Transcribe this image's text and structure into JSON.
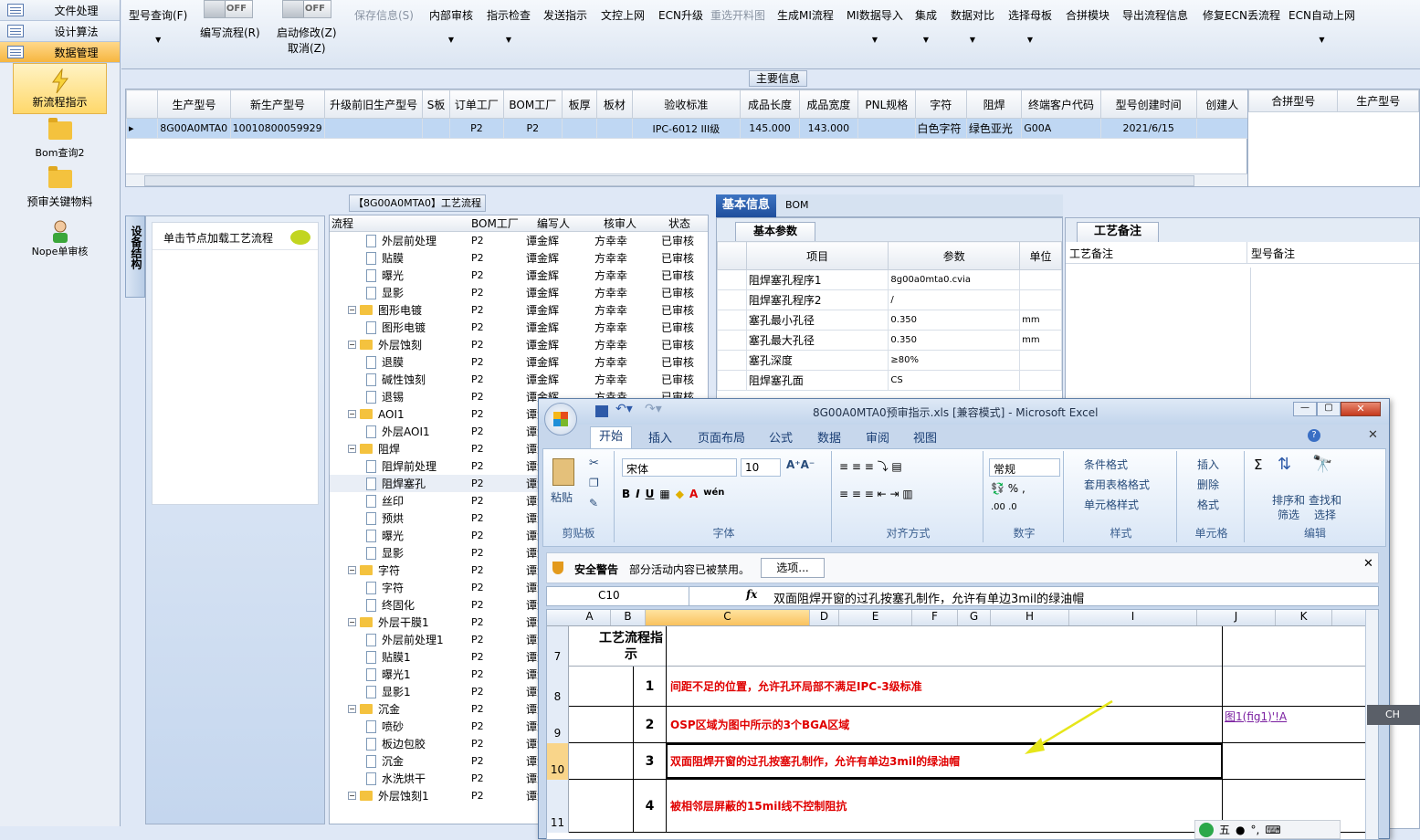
{
  "nav": {
    "top": [
      "文件处理",
      "设计算法",
      "数据管理"
    ],
    "items": [
      "新流程指示",
      "Bom查询2",
      "预审关键物料",
      "Nope单审核"
    ]
  },
  "toolbar": {
    "model_query": "型号查询(F)",
    "write_flow": "编写流程(R)",
    "start_modify": "启动修改(Z)",
    "cancel": "取消(Z)",
    "off": "OFF",
    "buttons": [
      "保存信息(S)",
      "内部审核",
      "指示检查",
      "发送指示",
      "文控上网",
      "ECN升级",
      "重选开料图",
      "生成MI流程",
      "MI数据导入",
      "集成",
      "数据对比",
      "选择母板",
      "合拼模块",
      "导出流程信息",
      "修复ECN丢流程",
      "ECN自动上网"
    ]
  },
  "main_info": {
    "title": "主要信息",
    "headers": [
      "生产型号",
      "新生产型号",
      "升级前旧生产型号",
      "S板",
      "订单工厂",
      "BOM工厂",
      "板厚",
      "板材",
      "验收标准",
      "成品长度",
      "成品宽度",
      "PNL规格",
      "字符",
      "阻焊",
      "终端客户代码",
      "型号创建时间",
      "创建人"
    ],
    "row": [
      "8G00A0MTA0",
      "10010800059929",
      "",
      "",
      "P2",
      "P2",
      "",
      "",
      "IPC-6012 III级",
      "145.000",
      "143.000",
      "",
      "白色字符",
      "绿色亚光",
      "G00A",
      "2021/6/15",
      ""
    ],
    "right_headers": [
      "合拼型号",
      "生产型号"
    ]
  },
  "flow": {
    "title": "【8G00A0MTA0】工艺流程",
    "side_tab": "设备结构",
    "hint": "单击节点加载工艺流程",
    "headers": [
      "流程",
      "BOM工厂",
      "编写人",
      "核审人",
      "状态"
    ],
    "rows": [
      {
        "n": "外层前处理",
        "t": "d",
        "l": 2
      },
      {
        "n": "贴膜",
        "t": "d",
        "l": 2
      },
      {
        "n": "曝光",
        "t": "d",
        "l": 2
      },
      {
        "n": "显影",
        "t": "d",
        "l": 2
      },
      {
        "n": "图形电镀",
        "t": "f",
        "l": 1
      },
      {
        "n": "图形电镀",
        "t": "d",
        "l": 2
      },
      {
        "n": "外层蚀刻",
        "t": "f",
        "l": 1
      },
      {
        "n": "退膜",
        "t": "d",
        "l": 2
      },
      {
        "n": "碱性蚀刻",
        "t": "d",
        "l": 2
      },
      {
        "n": "退锡",
        "t": "d",
        "l": 2
      },
      {
        "n": "AOI1",
        "t": "f",
        "l": 1
      },
      {
        "n": "外层AOI1",
        "t": "d",
        "l": 2
      },
      {
        "n": "阻焊",
        "t": "f",
        "l": 1
      },
      {
        "n": "阻焊前处理",
        "t": "d",
        "l": 2
      },
      {
        "n": "阻焊塞孔",
        "t": "d",
        "l": 2
      },
      {
        "n": "丝印",
        "t": "d",
        "l": 2
      },
      {
        "n": "预烘",
        "t": "d",
        "l": 2
      },
      {
        "n": "曝光",
        "t": "d",
        "l": 2
      },
      {
        "n": "显影",
        "t": "d",
        "l": 2
      },
      {
        "n": "字符",
        "t": "f",
        "l": 1
      },
      {
        "n": "字符",
        "t": "d",
        "l": 2
      },
      {
        "n": "终固化",
        "t": "d",
        "l": 2
      },
      {
        "n": "外层干膜1",
        "t": "f",
        "l": 1
      },
      {
        "n": "外层前处理1",
        "t": "d",
        "l": 2
      },
      {
        "n": "贴膜1",
        "t": "d",
        "l": 2
      },
      {
        "n": "曝光1",
        "t": "d",
        "l": 2
      },
      {
        "n": "显影1",
        "t": "d",
        "l": 2
      },
      {
        "n": "沉金",
        "t": "f",
        "l": 1
      },
      {
        "n": "喷砂",
        "t": "d",
        "l": 2
      },
      {
        "n": "板边包胶",
        "t": "d",
        "l": 2
      },
      {
        "n": "沉金",
        "t": "d",
        "l": 2
      },
      {
        "n": "水洗烘干",
        "t": "d",
        "l": 2
      },
      {
        "n": "外层蚀刻1",
        "t": "f",
        "l": 1
      }
    ],
    "bom": "P2",
    "writer": "谭金辉",
    "reviewer": "方幸幸",
    "status": "已审核"
  },
  "basic": {
    "tabs": [
      "基本信息",
      "BOM"
    ],
    "subtab": "基本参数",
    "headers": [
      "项目",
      "参数",
      "单位"
    ],
    "rows": [
      [
        "阻焊塞孔程序1",
        "8g00a0mta0.cvia",
        ""
      ],
      [
        "阻焊塞孔程序2",
        "/",
        ""
      ],
      [
        "塞孔最小孔径",
        "0.350",
        "mm"
      ],
      [
        "塞孔最大孔径",
        "0.350",
        "mm"
      ],
      [
        "塞孔深度",
        "≥80%",
        ""
      ],
      [
        "阻焊塞孔面",
        "CS",
        ""
      ]
    ]
  },
  "remarks": {
    "tab": "工艺备注",
    "col1": "工艺备注",
    "col2": "型号备注"
  },
  "excel": {
    "title": "8G00A0MTA0预审指示.xls [兼容模式] - Microsoft Excel",
    "tabs": [
      "开始",
      "插入",
      "页面布局",
      "公式",
      "数据",
      "审阅",
      "视图"
    ],
    "groups": {
      "clipboard": "剪贴板",
      "font": "字体",
      "align": "对齐方式",
      "number": "数字",
      "style": "样式",
      "cells": "单元格",
      "edit": "编辑"
    },
    "paste": "粘贴",
    "font_name": "宋体",
    "font_size": "10",
    "num_format": "常规",
    "style_items": [
      "条件格式",
      "套用表格格式",
      "单元格样式"
    ],
    "cell_items": [
      "插入",
      "删除",
      "格式"
    ],
    "edit_items": [
      "排序和筛选",
      "查找和选择"
    ],
    "security_label": "安全警告",
    "security_msg": "部分活动内容已被禁用。",
    "options": "选项...",
    "namebox": "C10",
    "formula": "双面阻焊开窗的过孔按塞孔制作，允许有单边3mil的绿油帽",
    "cols": [
      "A",
      "B",
      "C",
      "D",
      "E",
      "F",
      "G",
      "H",
      "I",
      "J",
      "K"
    ],
    "header_cell": "工艺流程指示",
    "link": "图1(fig1)'!A",
    "rows": [
      {
        "r": "8",
        "n": "1",
        "t": "间距不足的位置，允许孔环局部不满足IPC-3级标准"
      },
      {
        "r": "9",
        "n": "2",
        "t": "OSP区域为图中所示的3个BGA区域"
      },
      {
        "r": "10",
        "n": "3",
        "t": "双面阻焊开窗的过孔按塞孔制作，允许有单边3mil的绿油帽"
      },
      {
        "r": "11",
        "n": "4",
        "t": "被相邻层屏蔽的15mil线不控制阻抗"
      }
    ]
  },
  "ime": {
    "lang": "CH",
    "mode": "五"
  }
}
